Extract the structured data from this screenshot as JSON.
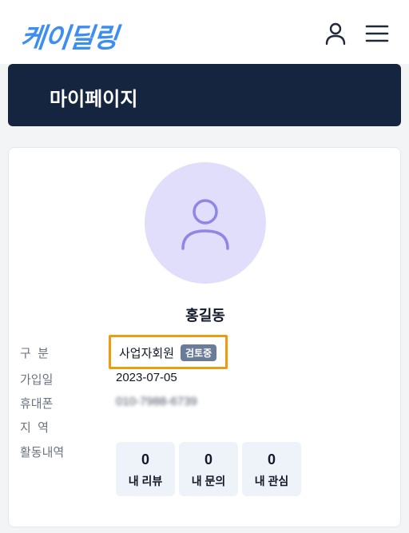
{
  "header": {
    "logo": "케이딜링",
    "user_icon": "user-icon",
    "menu_icon": "hamburger-menu-icon"
  },
  "page_title": "마이페이지",
  "profile": {
    "name": "홍길동",
    "rows": {
      "member_type": {
        "label": "구  분",
        "value": "사업자회원",
        "badge": "검토중"
      },
      "join_date": {
        "label": "가입일",
        "value": "2023-07-05"
      },
      "phone": {
        "label": "휴대폰",
        "value": "010-7988-6739"
      },
      "region": {
        "label": "지  역",
        "value": ""
      },
      "activity": {
        "label": "활동내역"
      }
    },
    "stats": [
      {
        "count": "0",
        "label": "내 리뷰"
      },
      {
        "count": "0",
        "label": "내 문의"
      },
      {
        "count": "0",
        "label": "내 관심"
      }
    ]
  },
  "colors": {
    "brand": "#3d8ef0",
    "title_bar": "#15253f",
    "highlight_border": "#ef9b0f",
    "badge": "#6b7c98",
    "avatar_bg": "#e0defa"
  }
}
